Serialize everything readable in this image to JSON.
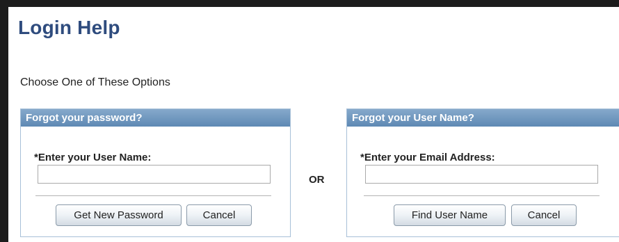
{
  "page": {
    "title": "Login Help",
    "instructions": "Choose One of These Options",
    "separator": "OR"
  },
  "password_panel": {
    "header": "Forgot your password?",
    "field_label": "*Enter your User Name:",
    "field_value": "",
    "submit_label": "Get New Password",
    "cancel_label": "Cancel"
  },
  "username_panel": {
    "header": "Forgot your User Name?",
    "field_label": "*Enter your Email Address:",
    "field_value": "",
    "submit_label": "Find User Name",
    "cancel_label": "Cancel"
  },
  "colors": {
    "title": "#2f4c7e",
    "panel_header_top": "#86a9cb",
    "panel_header_bottom": "#5e89b4",
    "panel_border": "#a7c0d8",
    "frame": "#1c1c1c"
  }
}
